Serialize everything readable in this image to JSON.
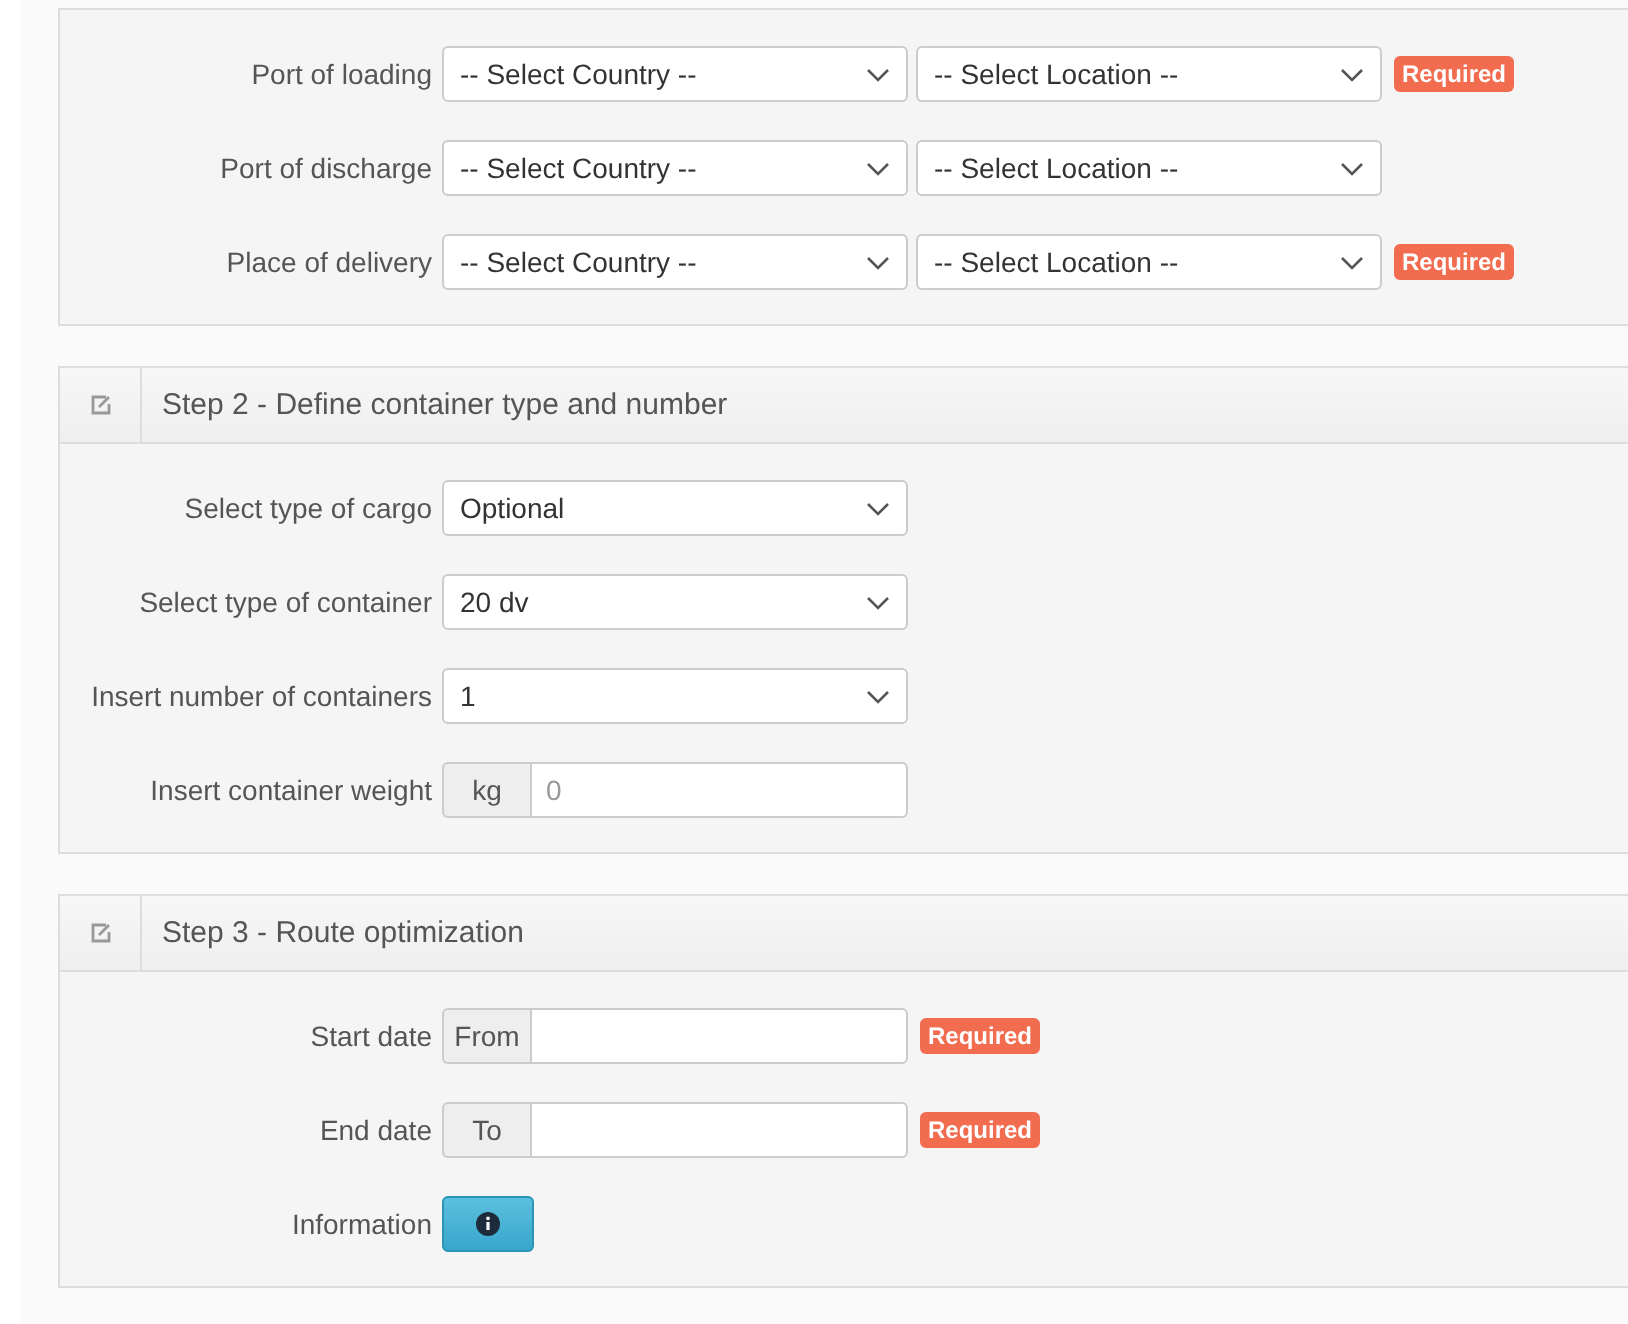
{
  "sections": [
    {
      "rows": [
        {
          "kind": "select_pair",
          "label": "Port of loading",
          "selects": [
            "-- Select Country --",
            "-- Select Location --"
          ],
          "badge": "Required"
        },
        {
          "kind": "select_pair",
          "label": "Port of discharge",
          "selects": [
            "-- Select Country --",
            "-- Select Location --"
          ]
        },
        {
          "kind": "select_pair",
          "label": "Place of delivery",
          "selects": [
            "-- Select Country --",
            "-- Select Location --"
          ],
          "badge": "Required"
        }
      ]
    },
    {
      "title": "Step 2 - Define container type and number",
      "rows": [
        {
          "kind": "select",
          "label": "Select type of cargo",
          "value": "Optional"
        },
        {
          "kind": "select",
          "label": "Select type of container",
          "value": "20 dv"
        },
        {
          "kind": "select",
          "label": "Insert number of containers",
          "value": "1"
        },
        {
          "kind": "addon_input",
          "label": "Insert container weight",
          "addon": "kg",
          "placeholder": "0"
        }
      ]
    },
    {
      "title": "Step 3 - Route optimization",
      "rows": [
        {
          "kind": "addon_input",
          "label": "Start date",
          "addon": "From",
          "badge": "Required"
        },
        {
          "kind": "addon_input",
          "label": "End date",
          "addon": "To",
          "badge": "Required"
        },
        {
          "kind": "button",
          "label": "Information"
        }
      ]
    }
  ]
}
